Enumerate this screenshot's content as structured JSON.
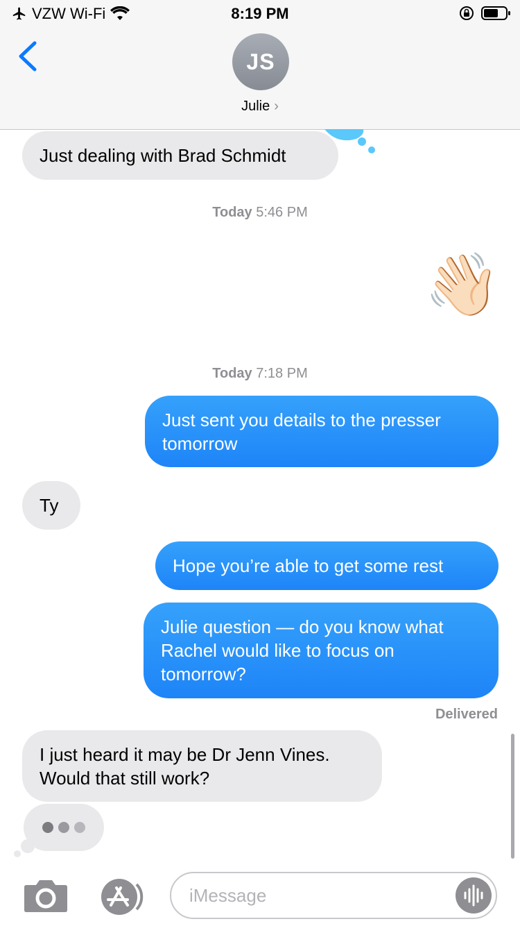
{
  "status_bar": {
    "carrier": "VZW Wi-Fi",
    "time": "8:19 PM"
  },
  "header": {
    "avatar_initials": "JS",
    "contact_name": "Julie",
    "back_icon": "chevron-left-icon",
    "chevron": "›"
  },
  "thread": {
    "messages": [
      {
        "type": "incoming",
        "text": "Just dealing with Brad Schmidt"
      },
      {
        "type": "timestamp",
        "day": "Today",
        "time": "5:46 PM"
      },
      {
        "type": "outgoing-emoji",
        "text": "👋🏻"
      },
      {
        "type": "timestamp",
        "day": "Today",
        "time": "7:18 PM"
      },
      {
        "type": "outgoing",
        "text": "Just sent you details to the presser tomorrow"
      },
      {
        "type": "incoming",
        "text": "Ty"
      },
      {
        "type": "outgoing",
        "text": "Hope you’re able to get some rest"
      },
      {
        "type": "outgoing",
        "text": "Julie question — do you know what Rachel would like to focus on tomorrow?"
      },
      {
        "type": "incoming",
        "text": "I just heard it may be Dr Jenn Vines. Would that still work?"
      }
    ],
    "delivered_label": "Delivered",
    "typing_indicator": "typing-dots-icon"
  },
  "input_bar": {
    "placeholder": "iMessage",
    "camera_icon": "camera-icon",
    "app_store_icon": "app-store-icon",
    "audio_icon": "waveform-icon"
  },
  "colors": {
    "outgoing_bubble": "#1e84f8",
    "incoming_bubble": "#e9e9eb",
    "accent": "#0a7aff"
  }
}
